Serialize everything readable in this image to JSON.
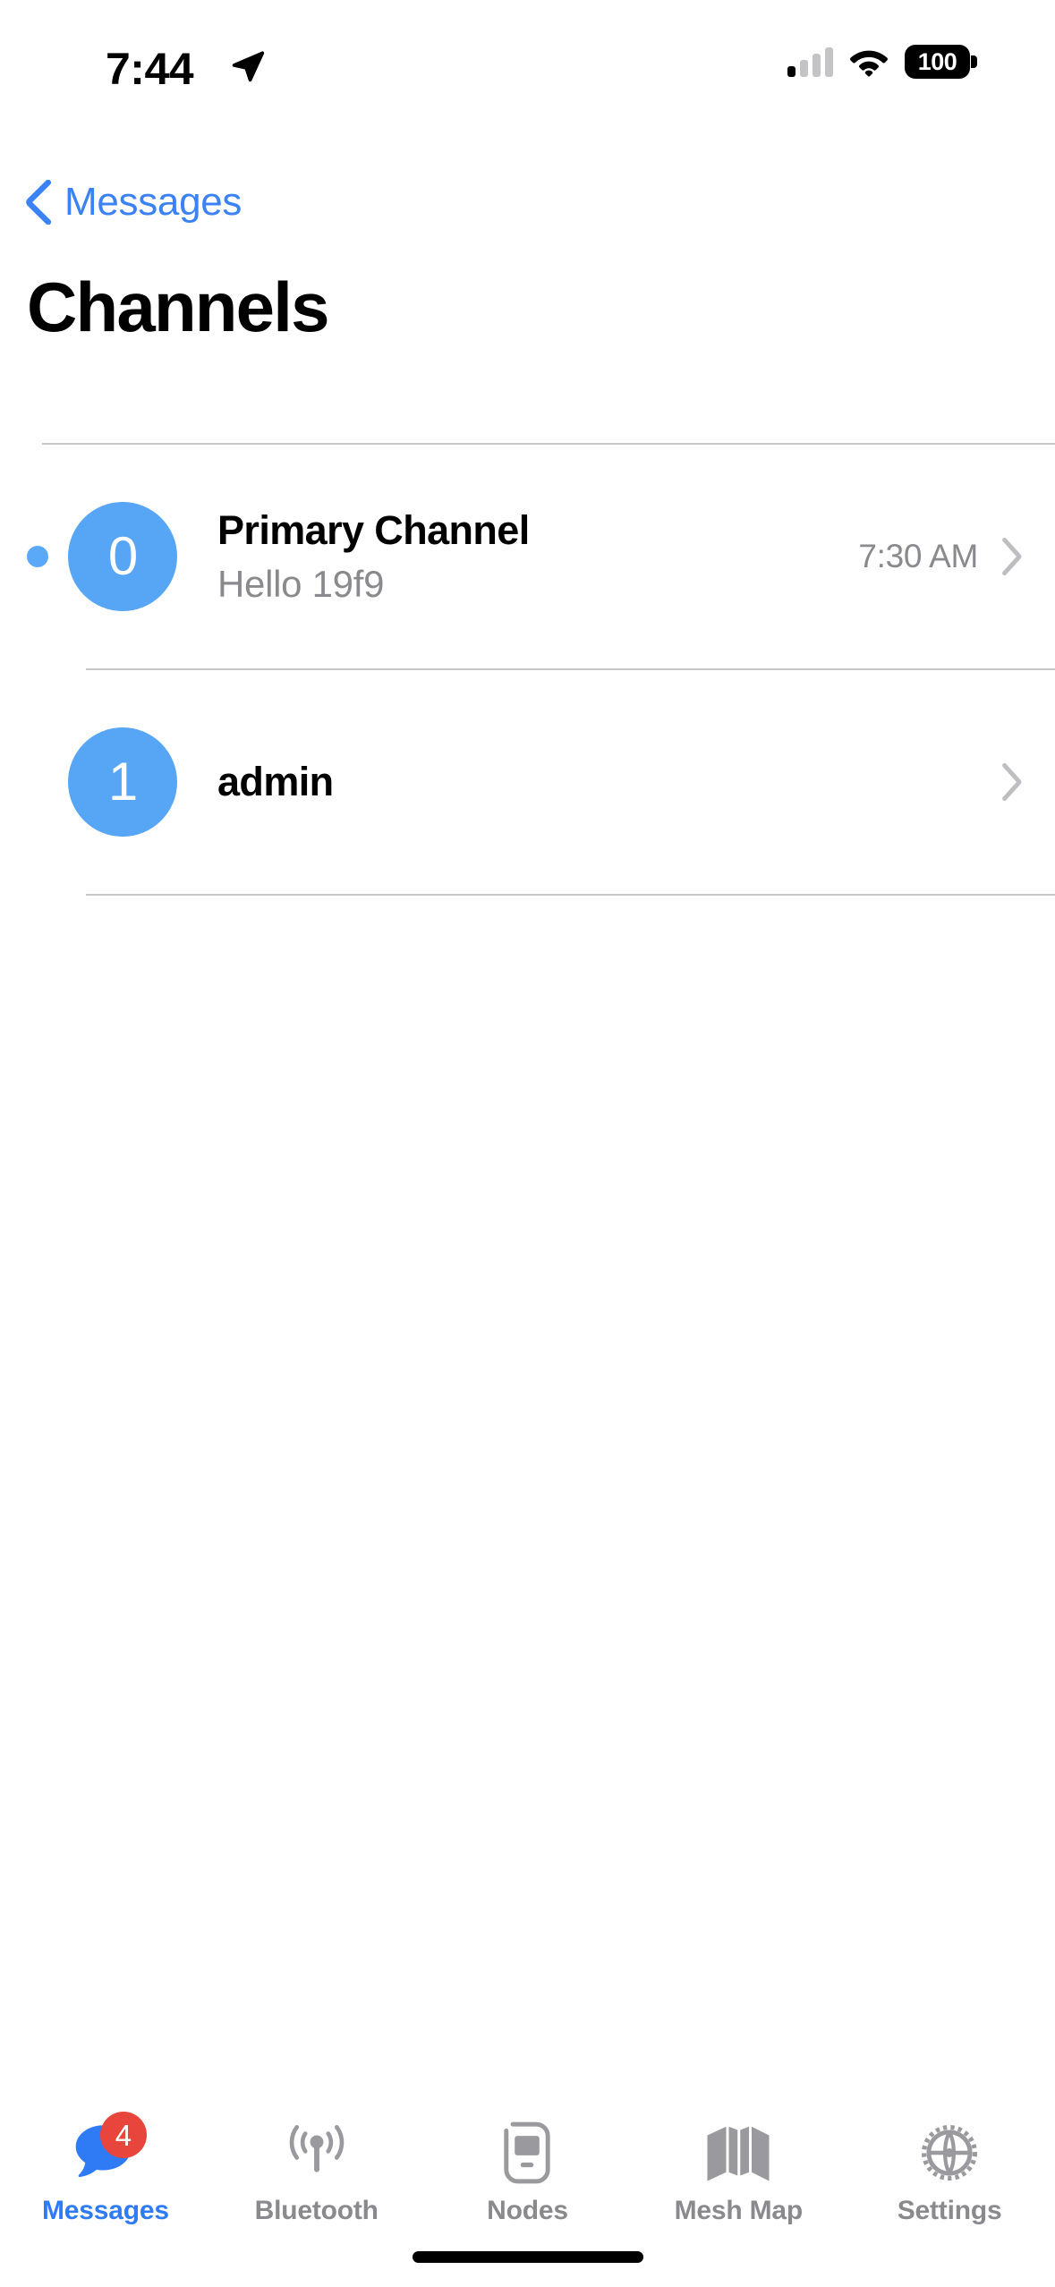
{
  "status_bar": {
    "time": "7:44",
    "location_icon": "location-arrow-icon",
    "cellular_icon": "cellular-signal-icon",
    "cellular_bars_filled": 1,
    "cellular_bars_total": 4,
    "wifi_icon": "wifi-icon",
    "battery_percent": "100",
    "battery_icon": "battery-full-icon"
  },
  "nav": {
    "back_label": "Messages",
    "back_icon": "chevron-left-icon",
    "accent_color": "#3b82f6"
  },
  "header": {
    "title": "Channels"
  },
  "channels": [
    {
      "unread": true,
      "index": "0",
      "name": "Primary Channel",
      "preview": "Hello 19f9",
      "time": "7:30 AM",
      "chevron_icon": "chevron-right-icon"
    },
    {
      "unread": false,
      "index": "1",
      "name": "admin",
      "preview": "",
      "time": "",
      "chevron_icon": "chevron-right-icon"
    }
  ],
  "tabbar": {
    "items": [
      {
        "label": "Messages",
        "icon": "message-bubble-icon",
        "badge": "4",
        "active": true
      },
      {
        "label": "Bluetooth",
        "icon": "antenna-broadcast-icon",
        "badge": "",
        "active": false
      },
      {
        "label": "Nodes",
        "icon": "mobile-device-icon",
        "badge": "",
        "active": false
      },
      {
        "label": "Mesh Map",
        "icon": "folded-map-icon",
        "badge": "",
        "active": false
      },
      {
        "label": "Settings",
        "icon": "gear-icon",
        "badge": "",
        "active": false
      }
    ],
    "active_color": "#2f7bf5",
    "inactive_color": "#8a8a8e",
    "badge_color": "#e8453c"
  },
  "colors": {
    "avatar_blue": "#57a5f5",
    "separator": "#c6c6c8",
    "secondary_text": "#8a8a8e"
  }
}
